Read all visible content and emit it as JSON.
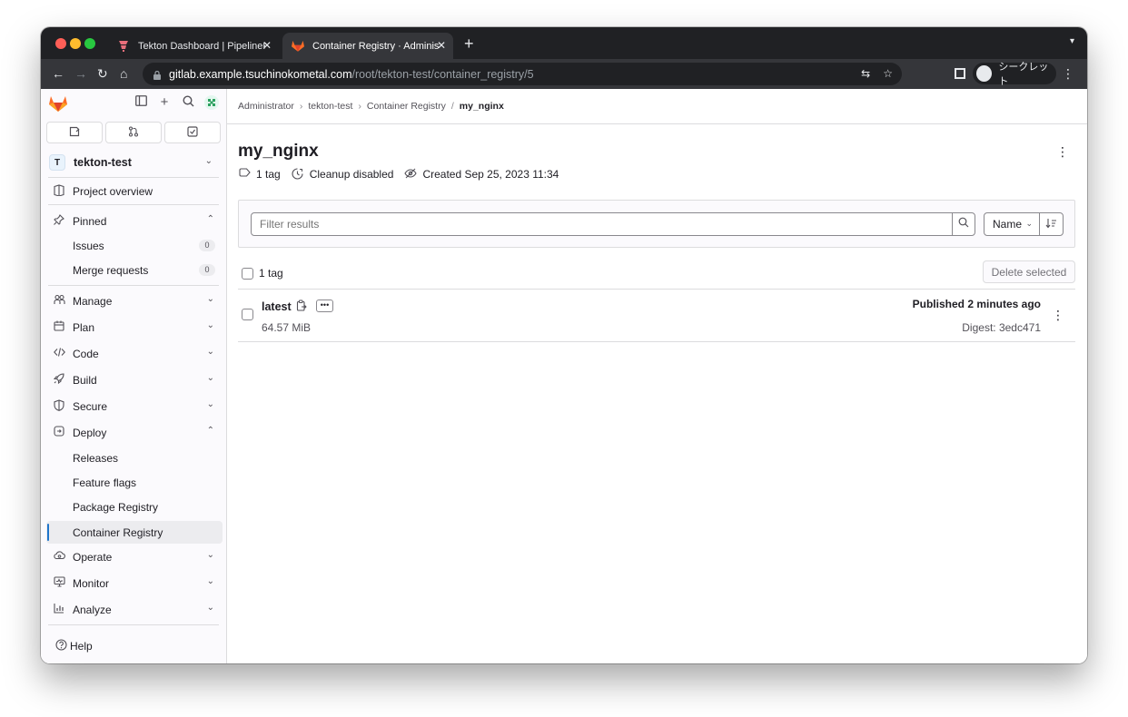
{
  "browser": {
    "tabs": [
      {
        "title": "Tekton Dashboard | PipelineRuns",
        "active": false
      },
      {
        "title": "Container Registry · Administrator",
        "active": true
      }
    ],
    "url_host": "gitlab.example.tsuchinokometal.com",
    "url_path": "/root/tekton-test/container_registry/5",
    "profile_label": "シークレット"
  },
  "sidebar": {
    "counts": [
      {
        "icon": "issues-icon"
      },
      {
        "icon": "merge-request-icon"
      },
      {
        "icon": "todo-icon"
      }
    ],
    "project_initial": "T",
    "project_name": "tekton-test",
    "items": {
      "project_overview": "Project overview",
      "pinned": "Pinned",
      "issues": "Issues",
      "issues_count": "0",
      "merge_requests": "Merge requests",
      "merge_requests_count": "0",
      "manage": "Manage",
      "plan": "Plan",
      "code": "Code",
      "build": "Build",
      "secure": "Secure",
      "deploy": "Deploy",
      "releases": "Releases",
      "feature_flags": "Feature flags",
      "package_registry": "Package Registry",
      "container_registry": "Container Registry",
      "operate": "Operate",
      "monitor": "Monitor",
      "analyze": "Analyze",
      "help": "Help"
    }
  },
  "breadcrumb": [
    "Administrator",
    "tekton-test",
    "Container Registry",
    "my_nginx"
  ],
  "repo": {
    "title": "my_nginx",
    "tag_count": "1 tag",
    "cleanup": "Cleanup disabled",
    "created": "Created Sep 25, 2023 11:34"
  },
  "filter": {
    "placeholder": "Filter results",
    "sort_label": "Name"
  },
  "tags": {
    "header_count": "1 tag",
    "delete_label": "Delete selected",
    "rows": [
      {
        "name": "latest",
        "size": "64.57 MiB",
        "published": "Published 2 minutes ago",
        "digest": "Digest: 3edc471"
      }
    ]
  },
  "colors": {
    "accent": "#1f75cb",
    "gitlab_orange": "#e24329"
  }
}
